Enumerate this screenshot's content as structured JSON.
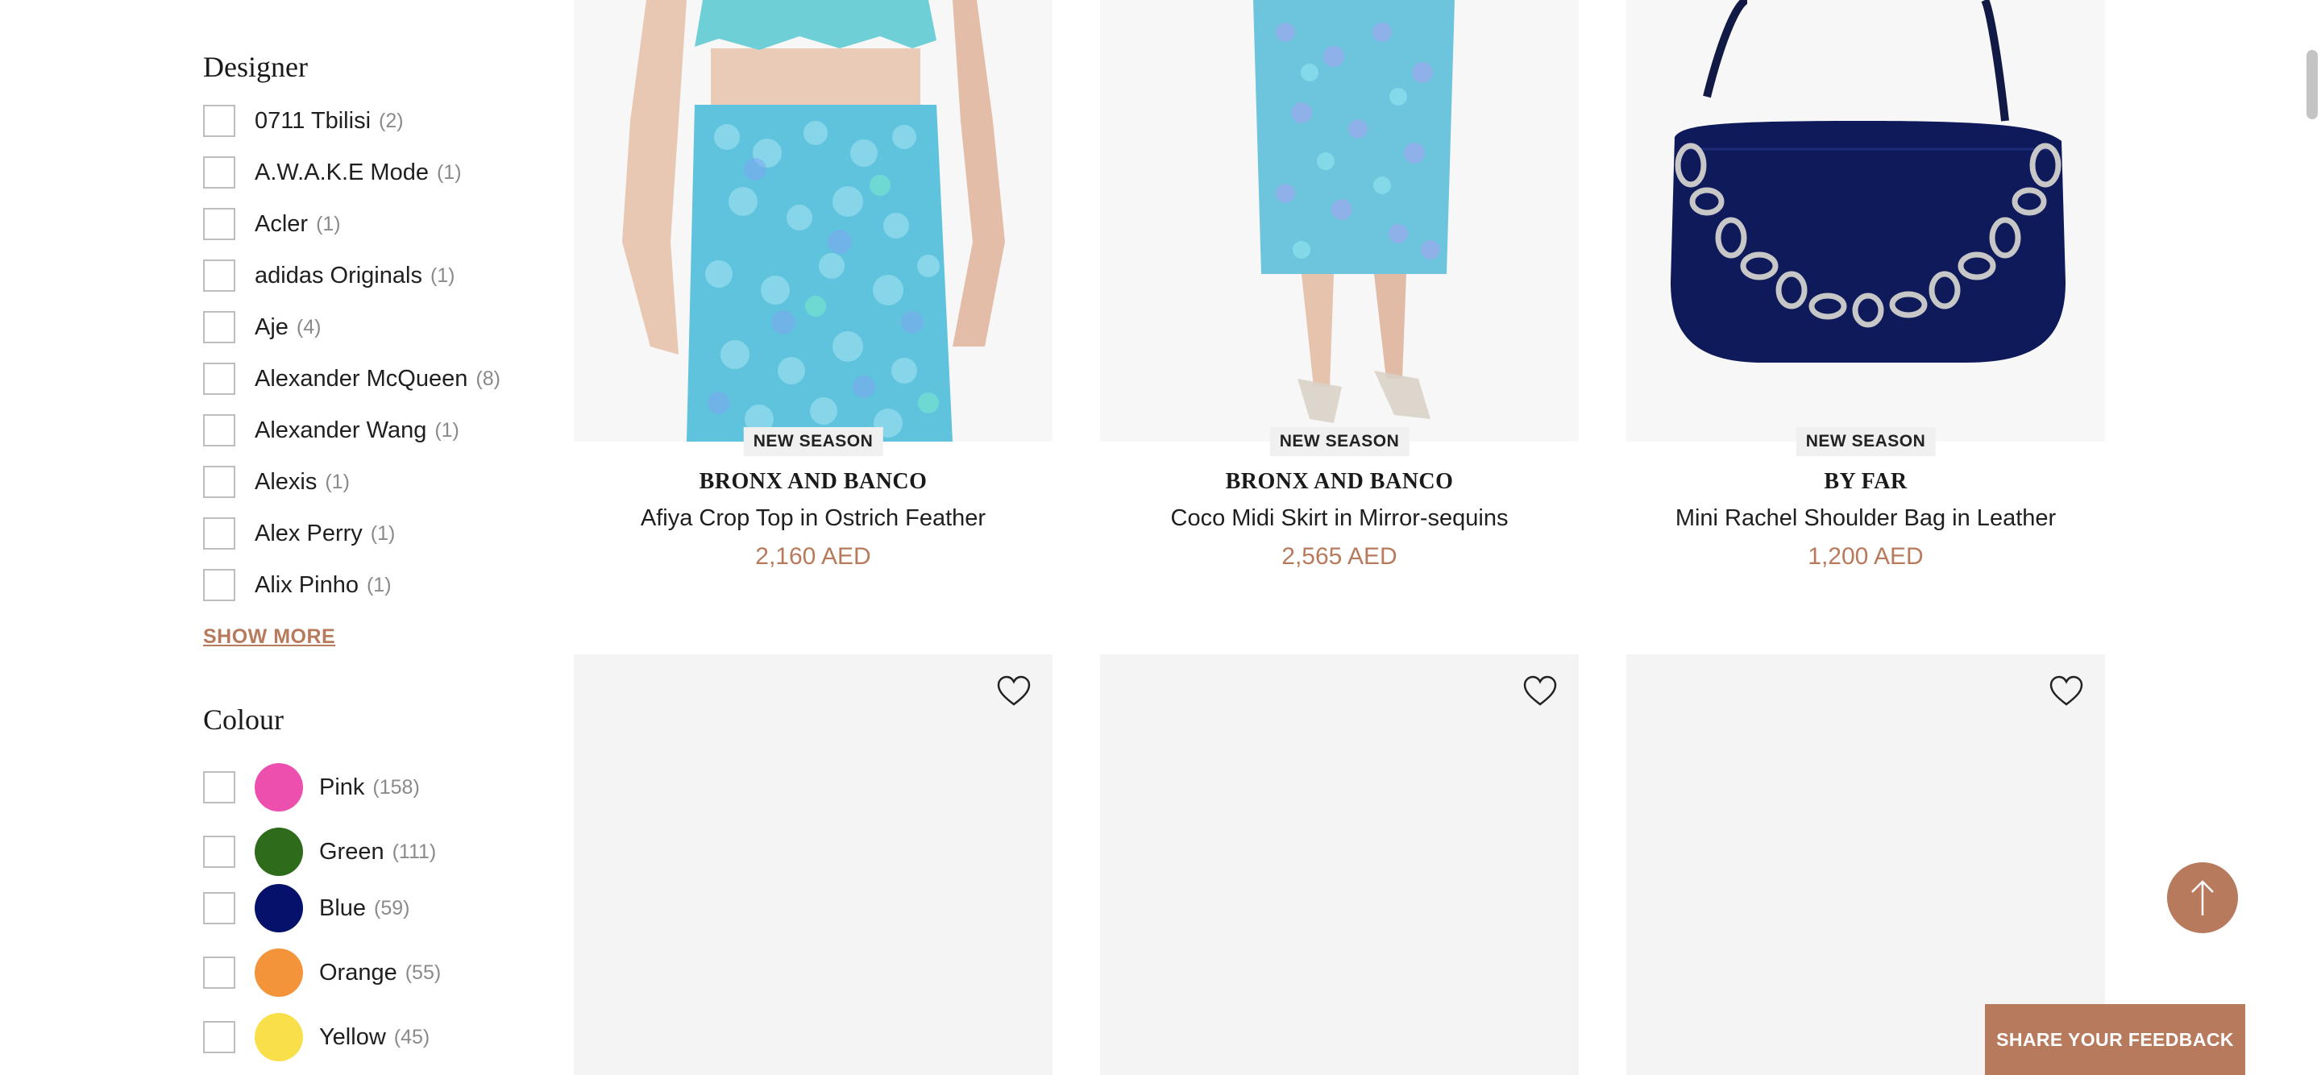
{
  "designer": {
    "title": "Designer",
    "items": [
      {
        "label": "0711 Tbilisi",
        "count": "(2)"
      },
      {
        "label": "A.W.A.K.E Mode",
        "count": "(1)"
      },
      {
        "label": "Acler",
        "count": "(1)"
      },
      {
        "label": "adidas Originals",
        "count": "(1)"
      },
      {
        "label": "Aje",
        "count": "(4)"
      },
      {
        "label": "Alexander McQueen",
        "count": "(8)"
      },
      {
        "label": "Alexander Wang",
        "count": "(1)"
      },
      {
        "label": "Alexis",
        "count": "(1)"
      },
      {
        "label": "Alex Perry",
        "count": "(1)"
      },
      {
        "label": "Alix Pinho",
        "count": "(1)"
      }
    ],
    "show_more": "SHOW MORE"
  },
  "colour": {
    "title": "Colour",
    "items": [
      {
        "label": "Pink",
        "count": "(158)",
        "swatch": "#ec4fae"
      },
      {
        "label": "Green",
        "count": "(111)",
        "swatch": "#2e6b1a"
      },
      {
        "label": "Blue",
        "count": "(59)",
        "swatch": "#05116b"
      },
      {
        "label": "Orange",
        "count": "(55)",
        "swatch": "#f3943a"
      },
      {
        "label": "Yellow",
        "count": "(45)",
        "swatch": "#f9e04a"
      }
    ]
  },
  "products": [
    {
      "badge": "NEW SEASON",
      "brand": "BRONX AND BANCO",
      "name": "Afiya Crop Top in Ostrich Feather",
      "price": "2,160 AED",
      "image": "sequin-skirt-feather-top"
    },
    {
      "badge": "NEW SEASON",
      "brand": "BRONX AND BANCO",
      "name": "Coco Midi Skirt in Mirror-sequins",
      "price": "2,565 AED",
      "image": "sequin-midi-skirt"
    },
    {
      "badge": "NEW SEASON",
      "brand": "BY FAR",
      "name": "Mini Rachel Shoulder Bag in Leather",
      "price": "1,200 AED",
      "image": "navy-chain-shoulder-bag"
    }
  ],
  "next_row_icons": [
    "heart-icon",
    "heart-icon",
    "heart-icon"
  ],
  "floating": {
    "feedback": "SHARE YOUR FEEDBACK",
    "to_top_icon": "arrow-up-icon"
  },
  "colors": {
    "accent": "#b87a5c",
    "placeholder": "#f4f4f4"
  }
}
